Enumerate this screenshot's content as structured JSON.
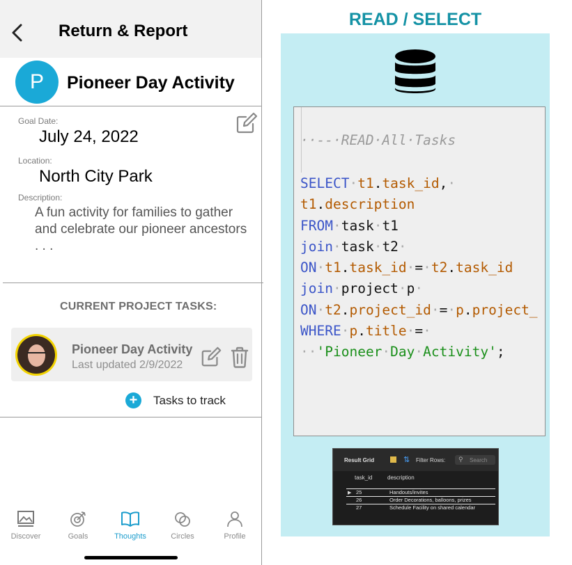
{
  "phone": {
    "header": {
      "title": "Return & Report"
    },
    "project": {
      "avatar_letter": "P",
      "name": "Pioneer Day Activity",
      "goal_date_label": "Goal Date:",
      "goal_date": "July 24, 2022",
      "location_label": "Location:",
      "location": "North City Park",
      "description_label": "Description:",
      "description": "A fun activity for families to gather and celebrate our pioneer ancestors . . ."
    },
    "tasks_section": {
      "title": "CURRENT PROJECT TASKS:",
      "items": [
        {
          "name": "Pioneer Day Activity",
          "updated": "Last updated 2/9/2022"
        }
      ],
      "add_label": "Tasks to track"
    },
    "tabbar": {
      "tabs": [
        {
          "label": "Discover",
          "icon": "image-icon"
        },
        {
          "label": "Goals",
          "icon": "target-icon"
        },
        {
          "label": "Thoughts",
          "icon": "book-icon",
          "active": true
        },
        {
          "label": "Circles",
          "icon": "circles-icon"
        },
        {
          "label": "Profile",
          "icon": "person-icon"
        }
      ],
      "active_color": "#1a9ccc"
    }
  },
  "panel": {
    "heading": "READ / SELECT",
    "background_color": "#c4edf3",
    "heading_color": "#1492a5",
    "icon": "database-icon",
    "sql": {
      "comment": "··--·READ·All·Tasks",
      "lines": [
        "SELECT·t1.task_id,·",
        "t1.description",
        "FROM·task·t1",
        "join·task·t2·",
        "ON·t1.task_id·=·t2.task_id",
        "join·project·p·",
        "ON·t2.project_id·=·p.project_",
        "WHERE·p.title·=·",
        "··'Pioneer·Day·Activity';"
      ]
    },
    "result_grid": {
      "title": "Result Grid",
      "filter_label": "Filter Rows:",
      "search_placeholder": "Search",
      "columns": [
        "task_id",
        "description"
      ],
      "rows": [
        [
          "25",
          "Handouts/invites"
        ],
        [
          "26",
          "Order Decorations, balloons, prizes"
        ],
        [
          "27",
          "Schedule Facility on shared calendar"
        ]
      ]
    }
  }
}
